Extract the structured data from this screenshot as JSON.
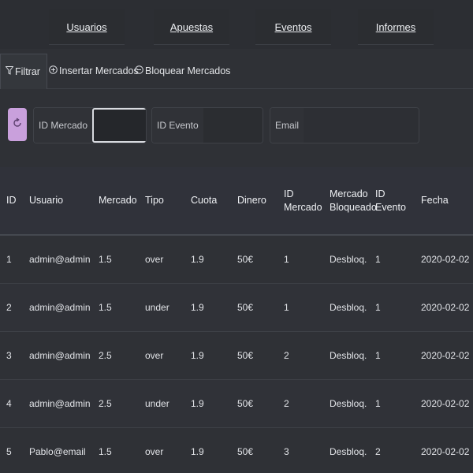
{
  "nav": {
    "items": [
      {
        "label": "Usuarios"
      },
      {
        "label": "Apuestas"
      },
      {
        "label": "Eventos"
      },
      {
        "label": "Informes"
      }
    ]
  },
  "tabs": {
    "filtrar": "Filtrar",
    "insertar": "Insertar Mercados",
    "bloquear": "Bloquear Mercados"
  },
  "filters": {
    "id_mercado_label": "ID Mercado",
    "id_mercado_value": "",
    "id_evento_label": "ID Evento",
    "id_evento_value": "",
    "email_label": "Email",
    "email_value": ""
  },
  "colors": {
    "reload_button": "#c9a0dc"
  },
  "icons": {
    "filter": "filter-icon",
    "insert": "plus-circle-icon",
    "block": "minus-circle-icon",
    "reload": "reload-icon"
  },
  "table": {
    "headers": {
      "id": "ID",
      "usuario": "Usuario",
      "mercado": "Mercado",
      "tipo": "Tipo",
      "cuota": "Cuota",
      "dinero": "Dinero",
      "id_mercado_1": "ID",
      "id_mercado_2": "Mercado",
      "bloq_1": "Mercado",
      "bloq_2": "Bloqueado",
      "id_evento_1": "ID",
      "id_evento_2": "Evento",
      "fecha": "Fecha"
    },
    "rows": [
      {
        "id": "1",
        "usuario": "admin@admin",
        "mercado": "1.5",
        "tipo": "over",
        "cuota": "1.9",
        "dinero": "50€",
        "id_mercado": "1",
        "bloqueado": "Desbloq.",
        "id_evento": "1",
        "fecha": "2020-02-02"
      },
      {
        "id": "2",
        "usuario": "admin@admin",
        "mercado": "1.5",
        "tipo": "under",
        "cuota": "1.9",
        "dinero": "50€",
        "id_mercado": "1",
        "bloqueado": "Desbloq.",
        "id_evento": "1",
        "fecha": "2020-02-02"
      },
      {
        "id": "3",
        "usuario": "admin@admin",
        "mercado": "2.5",
        "tipo": "over",
        "cuota": "1.9",
        "dinero": "50€",
        "id_mercado": "2",
        "bloqueado": "Desbloq.",
        "id_evento": "1",
        "fecha": "2020-02-02"
      },
      {
        "id": "4",
        "usuario": "admin@admin",
        "mercado": "2.5",
        "tipo": "under",
        "cuota": "1.9",
        "dinero": "50€",
        "id_mercado": "2",
        "bloqueado": "Desbloq.",
        "id_evento": "1",
        "fecha": "2020-02-02"
      },
      {
        "id": "5",
        "usuario": "Pablo@email",
        "mercado": "1.5",
        "tipo": "over",
        "cuota": "1.9",
        "dinero": "50€",
        "id_mercado": "3",
        "bloqueado": "Desbloq.",
        "id_evento": "2",
        "fecha": "2020-02-02"
      }
    ]
  }
}
